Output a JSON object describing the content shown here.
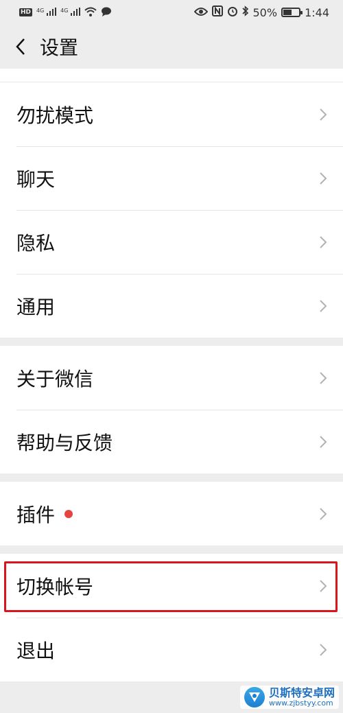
{
  "status_bar": {
    "left_badge": "HD",
    "net1": "4G",
    "net2": "4G",
    "battery": "50%",
    "time": "1:44"
  },
  "header": {
    "title": "设置"
  },
  "groups": [
    {
      "items": [
        {
          "label": "勿扰模式"
        },
        {
          "label": "聊天"
        },
        {
          "label": "隐私"
        },
        {
          "label": "通用"
        }
      ]
    },
    {
      "items": [
        {
          "label": "关于微信"
        },
        {
          "label": "帮助与反馈"
        }
      ]
    },
    {
      "items": [
        {
          "label": "插件",
          "badge": "red-dot"
        }
      ]
    },
    {
      "items": [
        {
          "label": "切换帐号",
          "highlighted": true
        },
        {
          "label": "退出"
        }
      ]
    }
  ],
  "watermark": {
    "name": "贝斯特安卓网",
    "url": "www.zjbstyy.com"
  },
  "colors": {
    "background": "#ededed",
    "row": "#ffffff",
    "highlight_border": "#d8161e",
    "red_dot": "#e64340"
  }
}
